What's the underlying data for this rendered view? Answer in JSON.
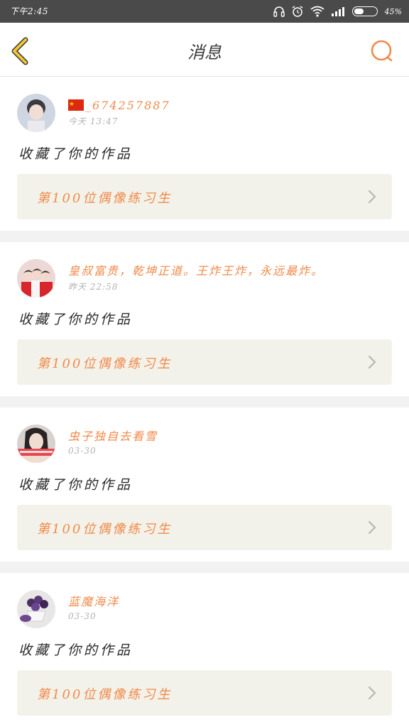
{
  "status_bar": {
    "time": "下午2:45",
    "battery_pct": "45%",
    "battery_level": 0.45
  },
  "header": {
    "title": "消息",
    "back_icon": "chevron-left-icon",
    "search_icon": "search-icon"
  },
  "colors": {
    "accent": "#f08a4b",
    "back_yellow": "#f2c733",
    "card_bg": "#f3f2ea"
  },
  "notifications": [
    {
      "username": "_674257887",
      "has_flag": true,
      "time": "今天 13:47",
      "action": "收藏了你的作品",
      "work_title": "第100位偶像练习生"
    },
    {
      "username": "皇叔富贵，乾坤正道。王炸王炸，永远最炸。",
      "has_flag": false,
      "time": "昨天 22:58",
      "action": "收藏了你的作品",
      "work_title": "第100位偶像练习生"
    },
    {
      "username": "虫子独自去看雪",
      "has_flag": false,
      "time": "03-30",
      "action": "收藏了你的作品",
      "work_title": "第100位偶像练习生"
    },
    {
      "username": "蓝魔海洋",
      "has_flag": false,
      "time": "03-30",
      "action": "收藏了你的作品",
      "work_title": "第100位偶像练习生"
    }
  ]
}
